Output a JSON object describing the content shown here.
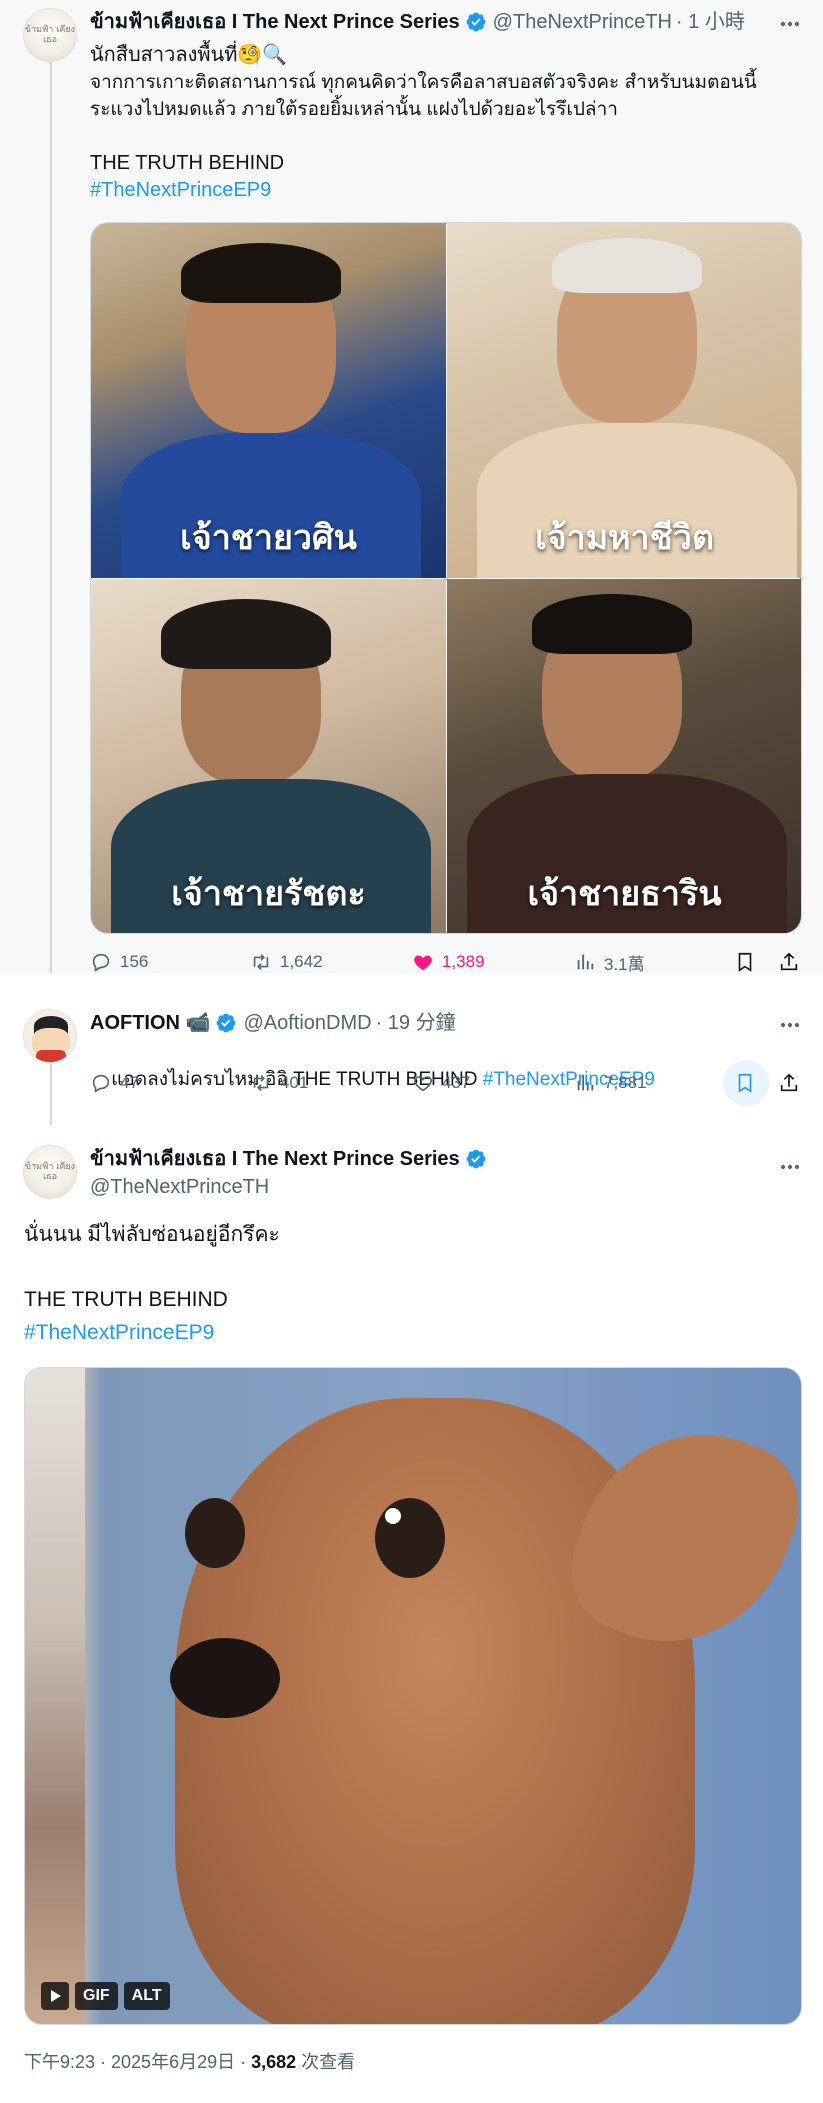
{
  "tweet1": {
    "author_name": "ข้ามฟ้าเคียงเธอ I The Next Prince Series",
    "handle": "@TheNextPrinceTH",
    "time": "· 1 小時",
    "line1": "นักสืบสาวลงพื้นที่🧐🔍",
    "line2": "จากการเกาะติดสถานการณ์ ทุกคนคิดว่าใครคือลาสบอสตัวจริงคะ สำหรับนมตอนนี้",
    "line3": "ระแวงไปหมดแล้ว ภายใต้รอยยิ้มเหล่านั้น แฝงไปด้วยอะไรรึเปล่าา",
    "line4": "THE TRUTH BEHIND",
    "hashtag": "#TheNextPrinceEP9",
    "photos": [
      {
        "caption": "เจ้าชายวศิน"
      },
      {
        "caption": "เจ้ามหาชีวิต"
      },
      {
        "caption": "เจ้าชายรัชตะ"
      },
      {
        "caption": "เจ้าชายธาริน"
      }
    ],
    "replies": "156",
    "retweets": "1,642",
    "likes": "1,389",
    "views": "3.1萬"
  },
  "tweet2": {
    "author_name": "AOFTION 📹",
    "handle": "@AoftionDMD",
    "time": "· 19 分鐘",
    "text": "แอดลงไม่ครบไหม อิอิ THE TRUTH BEHIND ",
    "hashtag": "#TheNextPrinceEP9",
    "replies": "47",
    "retweets": "401",
    "likes": "437",
    "views": "7,881"
  },
  "tweet3": {
    "author_name": "ข้ามฟ้าเคียงเธอ I The Next Prince Series",
    "handle": "@TheNextPrinceTH",
    "line1": "นั่นนน มีไพ่ลับซ่อนอยู่อีกรึคะ",
    "line2": "THE TRUTH BEHIND",
    "hashtag": "#TheNextPrinceEP9",
    "gif_label": "GIF",
    "alt_label": "ALT",
    "timestamp": "下午9:23 · 2025年6月29日 · ",
    "view_count": "3,682",
    "views_suffix": " 次查看"
  },
  "avatar_text": "ข้ามฟ้า\nเคียงเธอ",
  "colors": {
    "accent": "#1d9bf0",
    "like": "#f91880",
    "muted": "#536471",
    "thread_bg": "#f7f9f9"
  }
}
